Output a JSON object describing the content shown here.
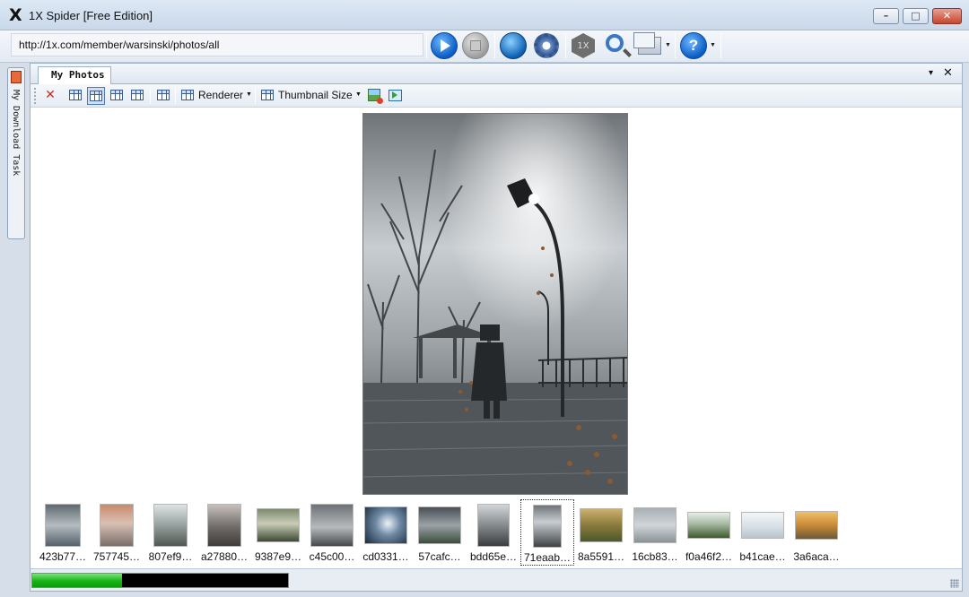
{
  "window": {
    "title": "1X Spider [Free Edition]",
    "app_icon_glyph": "X",
    "minimize_glyph": "–",
    "maximize_glyph": "□",
    "close_glyph": "✕"
  },
  "toolbar": {
    "address": "http://1x.com/member/warsinski/photos/all",
    "icons": [
      "play-icon",
      "stop-icon",
      "globe-icon",
      "settings-gear-icon",
      "1x-hex-icon",
      "search-magnifier-icon",
      "windows-icon",
      "help-icon"
    ],
    "hex_label": "1X",
    "help_glyph": "?"
  },
  "sidebar": {
    "tab_label": "My Download Task"
  },
  "document": {
    "tab_title": "My Photos",
    "dropdown_glyph": "▾",
    "close_glyph": "✕"
  },
  "subtoolbar": {
    "delete_glyph": "✕",
    "renderer_label": "Renderer",
    "thumbnail_size_label": "Thumbnail Size"
  },
  "thumbnails": [
    {
      "label": "423b77…",
      "selected": false
    },
    {
      "label": "757745…",
      "selected": false
    },
    {
      "label": "807ef9…",
      "selected": false
    },
    {
      "label": "a27880…",
      "selected": false
    },
    {
      "label": "9387e9…",
      "selected": false
    },
    {
      "label": "c45c00…",
      "selected": false
    },
    {
      "label": "cd0331…",
      "selected": false
    },
    {
      "label": "57cafc…",
      "selected": false
    },
    {
      "label": "bdd65e…",
      "selected": false
    },
    {
      "label": "71eaab…",
      "selected": true
    },
    {
      "label": "8a5591…",
      "selected": false
    },
    {
      "label": "16cb83…",
      "selected": false
    },
    {
      "label": "f0a46f2…",
      "selected": false
    },
    {
      "label": "b41cae…",
      "selected": false
    },
    {
      "label": "3a6aca…",
      "selected": false
    }
  ],
  "status": {
    "progress": 0.35
  },
  "colors": {
    "accent": "#0a5cc4",
    "progress_green": "#17b417",
    "close_red": "#c6462f"
  }
}
